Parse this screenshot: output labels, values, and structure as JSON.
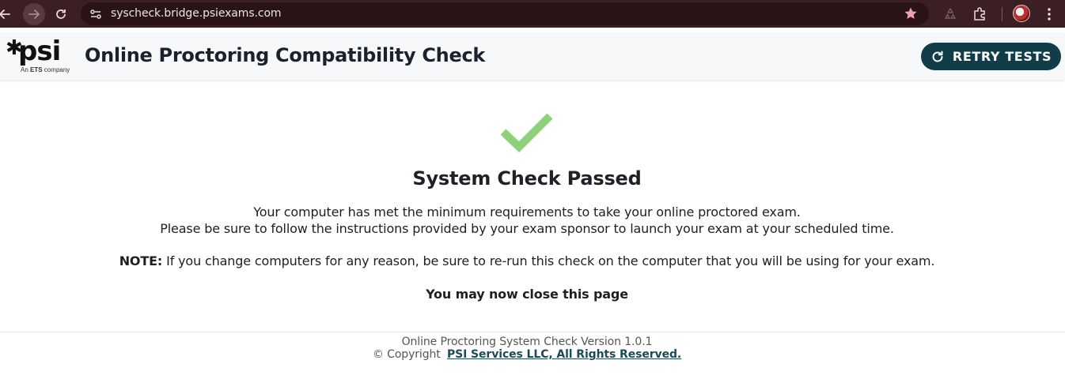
{
  "browser": {
    "url": "syscheck.bridge.psiexams.com"
  },
  "header": {
    "logo_text": "psi",
    "logo_tagline_prefix": "An",
    "logo_tagline_brand": "ETS",
    "logo_tagline_suffix": "company",
    "title": "Online Proctoring Compatibility Check",
    "retry_label": "RETRY TESTS"
  },
  "main": {
    "status_heading": "System Check Passed",
    "message_line1": "Your computer has met the minimum requirements to take your online proctored exam.",
    "message_line2": "Please be sure to follow the instructions provided by your exam sponsor to launch your exam at your scheduled time.",
    "note_label": "NOTE:",
    "note_text": " If you change computers for any reason, be sure to re-run this check on the computer that you will be using for your exam.",
    "close_message": "You may now close this page"
  },
  "footer": {
    "version": "Online Proctoring System Check Version 1.0.1",
    "copyright_prefix": "© Copyright",
    "copyright_link": "PSI Services LLC, All Rights Reserved."
  },
  "colors": {
    "chrome_bg": "#3c1f23",
    "header_bg": "#f7f8f9",
    "button_bg": "#113d4a",
    "check_green": "#8fd17a"
  }
}
